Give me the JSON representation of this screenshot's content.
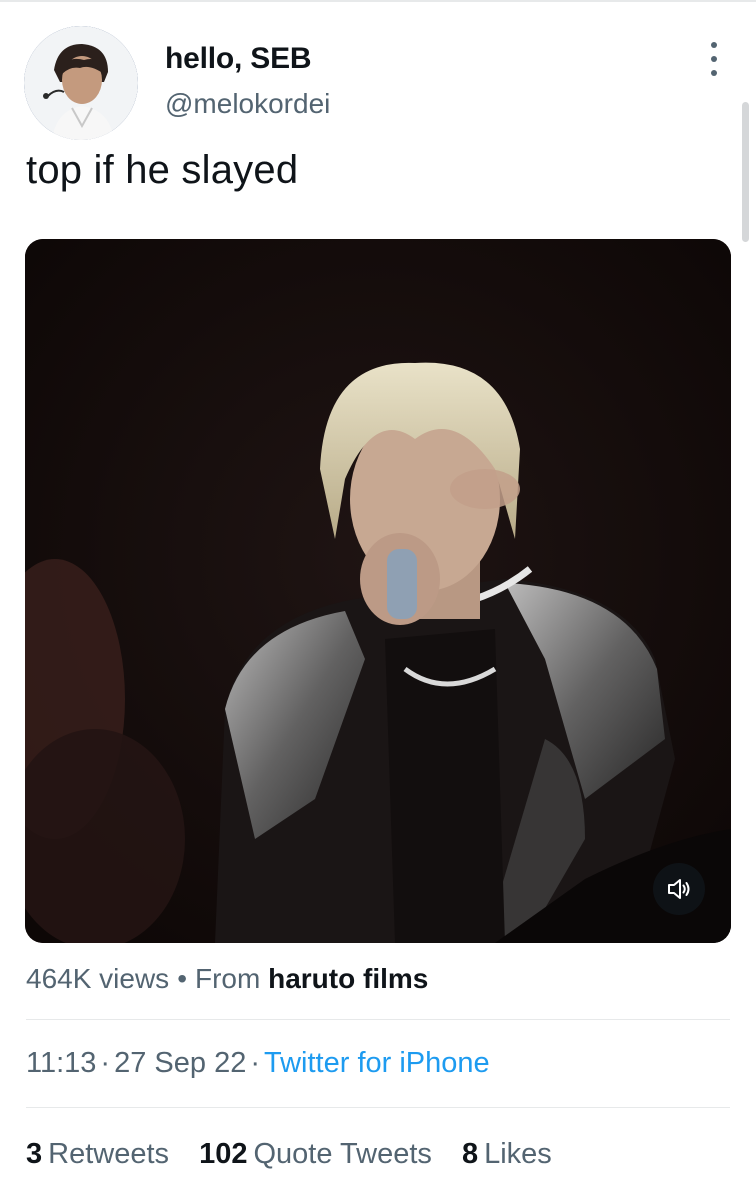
{
  "tweet": {
    "display_name": "hello, SEB",
    "handle": "@melokordei",
    "text": "top if he slayed",
    "avatar_icon": "avatar-photo",
    "more_icon": "more-vertical-icon"
  },
  "media": {
    "mute_icon": "speaker-muted-icon"
  },
  "views": {
    "count": "464K views",
    "bullet": "•",
    "from_label": "From",
    "source": "haruto films"
  },
  "meta": {
    "time": "11:13",
    "separator": "·",
    "date": "27 Sep 22",
    "client": "Twitter for iPhone"
  },
  "stats": [
    {
      "count": "3",
      "label": "Retweets"
    },
    {
      "count": "102",
      "label": "Quote Tweets"
    },
    {
      "count": "8",
      "label": "Likes"
    }
  ],
  "colors": {
    "link": "#1d9bf0",
    "secondary_text": "#536471",
    "primary_text": "#0f1419",
    "divider": "#e7e9ea"
  }
}
